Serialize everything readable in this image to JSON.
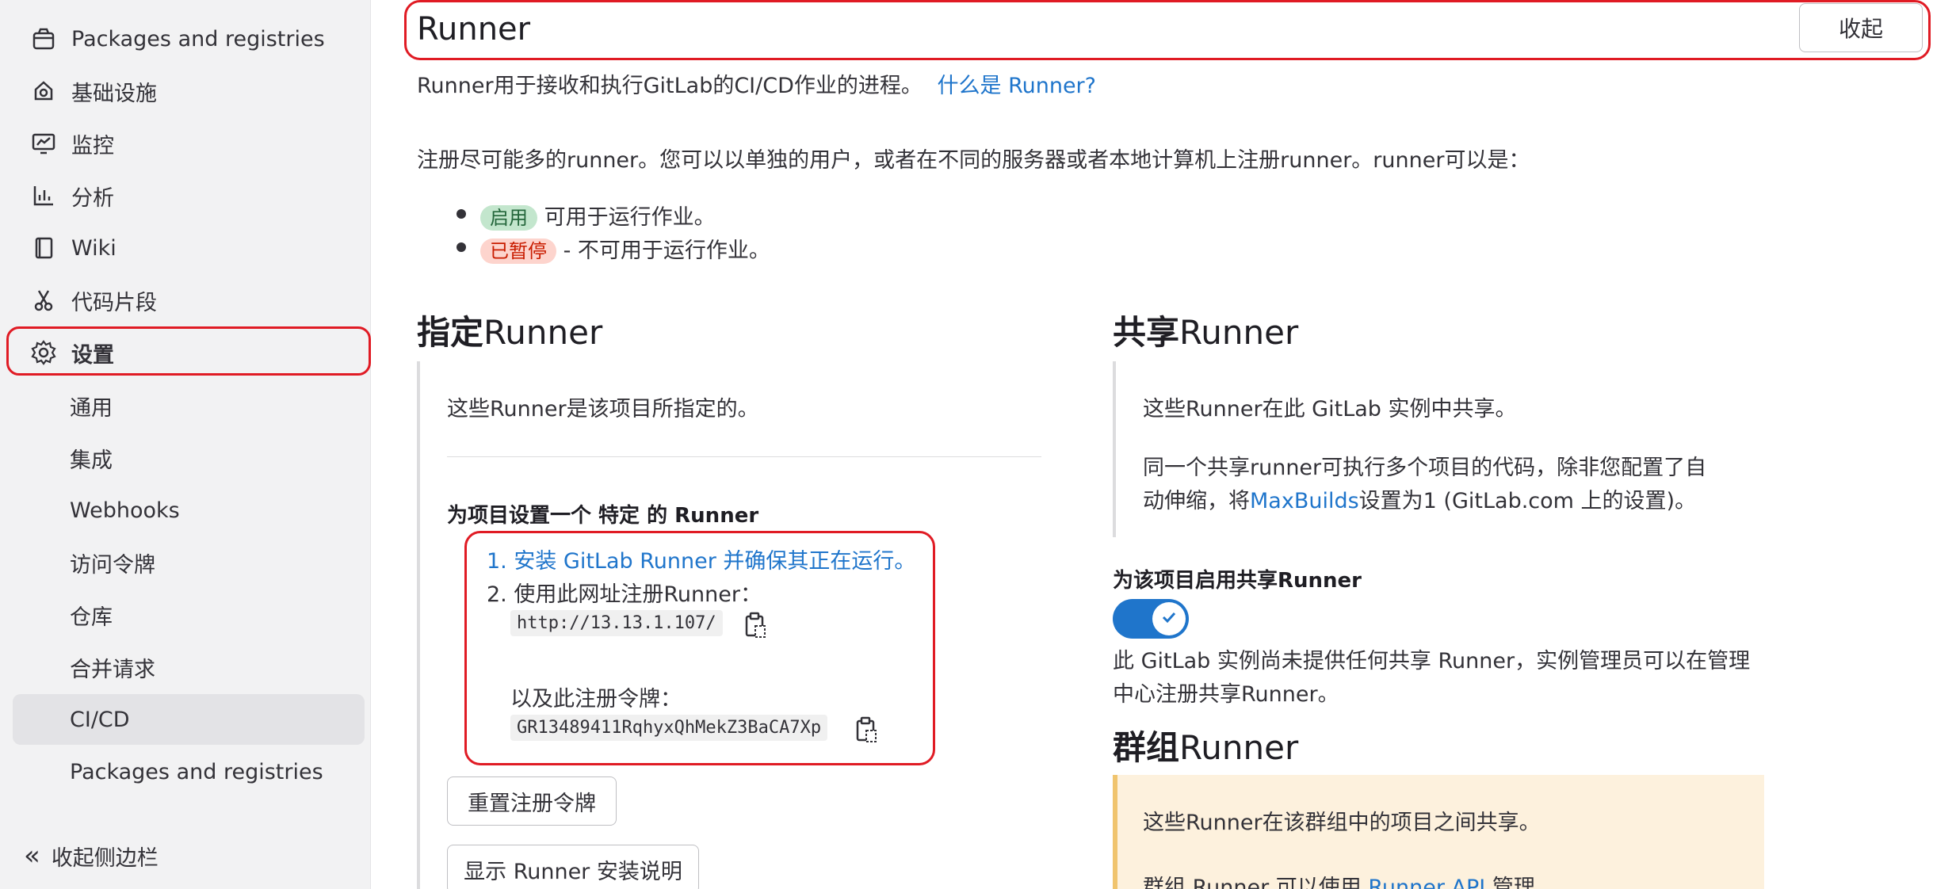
{
  "sidebar": {
    "items": [
      {
        "label": "Packages and registries",
        "icon": "package-icon"
      },
      {
        "label": "基础设施",
        "icon": "infrastructure-icon"
      },
      {
        "label": "监控",
        "icon": "monitor-icon"
      },
      {
        "label": "分析",
        "icon": "chart-icon"
      },
      {
        "label": "Wiki",
        "icon": "book-icon"
      },
      {
        "label": "代码片段",
        "icon": "snippet-icon"
      },
      {
        "label": "设置",
        "icon": "gear-icon"
      }
    ],
    "sub_items": [
      {
        "label": "通用"
      },
      {
        "label": "集成"
      },
      {
        "label": "Webhooks"
      },
      {
        "label": "访问令牌"
      },
      {
        "label": "仓库"
      },
      {
        "label": "合并请求"
      },
      {
        "label": "CI/CD"
      },
      {
        "label": "Packages and registries"
      }
    ],
    "collapse_label": "收起侧边栏"
  },
  "header": {
    "title": "Runner",
    "collapse_button": "收起"
  },
  "intro": {
    "text": "Runner用于接收和执行GitLab的CI/CD作业的进程。",
    "link": "什么是 Runner?",
    "register_text": "注册尽可能多的runner。您可以以单独的用户，或者在不同的服务器或者本地计算机上注册runner。runner可以是：",
    "status_list": [
      {
        "badge": "启用",
        "text": "可用于运行作业。"
      },
      {
        "badge": "已暂停",
        "text": "- 不可用于运行作业。"
      }
    ]
  },
  "specific": {
    "heading_bold": "指定",
    "heading_rest": "Runner",
    "desc": "这些Runner是该项目所指定的。",
    "setup_label": "为项目设置一个 特定 的 Runner",
    "step1": "1. 安装 GitLab Runner 并确保其正在运行。",
    "step2": "2. 使用此网址注册Runner：",
    "url": "http://13.13.1.107/",
    "token_label": "以及此注册令牌：",
    "token": "GR13489411RqhyxQhMekZ3BaCA7Xp",
    "reset_button": "重置注册令牌",
    "show_instructions_button": "显示 Runner 安装说明"
  },
  "shared": {
    "heading_bold": "共享",
    "heading_rest": "Runner",
    "desc1": "这些Runner在此 GitLab 实例中共享。",
    "desc2a": "同一个共享runner可执行多个项目的代码，除非您配置了自",
    "desc2b_pre": "动伸缩，将",
    "desc2b_link": "MaxBuilds",
    "desc2b_post": "设置为1 (GitLab.com 上的设置)。",
    "enable_label": "为该项目启用共享Runner",
    "toggle_on": true,
    "note_line1": "此 GitLab 实例尚未提供任何共享 Runner，实例管理员可以在管理",
    "note_line2": "中心注册共享Runner。"
  },
  "group": {
    "heading_bold": "群组",
    "heading_rest": "Runner",
    "desc1": "这些Runner在该群组中的项目之间共享。",
    "desc2_pre": "群组 Runner 可以使用 ",
    "desc2_link": "Runner API",
    "desc2_post": " 管理"
  },
  "colors": {
    "accent": "#1f75cb",
    "highlight": "#e01b24",
    "sidebar_bg": "#f2f2f3"
  }
}
